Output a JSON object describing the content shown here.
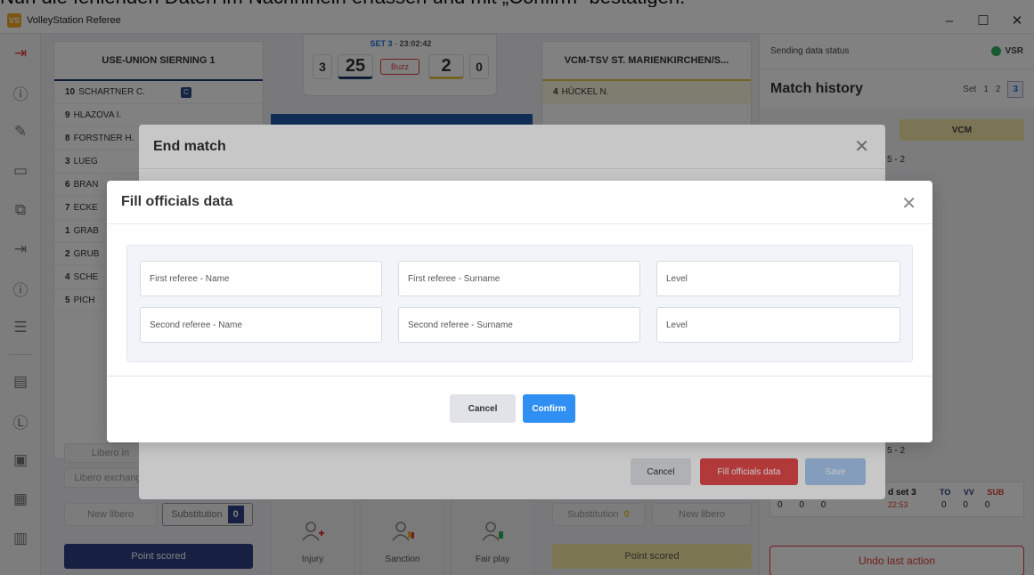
{
  "caption": "Nun die fehlenden Daten im Nachhinein erfassen und mit „Confirm“ bestätigen.",
  "window": {
    "title": "VolleyStation Referee"
  },
  "home_team": {
    "name": "USE-UNION SIERNING 1",
    "players": [
      {
        "num": "10",
        "name": "SCHARTNER C.",
        "captain": "C"
      },
      {
        "num": "9",
        "name": "HLAZOVA I."
      },
      {
        "num": "8",
        "name": "FORSTNER H."
      },
      {
        "num": "3",
        "name": "LUEG"
      },
      {
        "num": "6",
        "name": "BRAN"
      },
      {
        "num": "7",
        "name": "ECKE"
      },
      {
        "num": "1",
        "name": "GRAB"
      },
      {
        "num": "2",
        "name": "GRUB"
      },
      {
        "num": "4",
        "name": "SCHE"
      },
      {
        "num": "5",
        "name": "PICH"
      }
    ],
    "libero_in": "Libero in",
    "libero_exchange": "Libero exchange",
    "new_libero": "New libero",
    "substitution": "Substitution",
    "sub_count": "0",
    "point_scored": "Point scored"
  },
  "away_team": {
    "name": "VCM-TSV ST. MARIENKIRCHEN/S...",
    "players": [
      {
        "num": "4",
        "name": "HÜCKEL N."
      }
    ],
    "substitution": "Substitution",
    "sub_count": "0",
    "new_libero": "New libero",
    "point_scored": "Point scored"
  },
  "score": {
    "set_label": "SET 3",
    "sep": "-",
    "time": "23:02:42",
    "home_sets": "3",
    "home_points": "25",
    "buzz": "Buzz",
    "away_points": "2",
    "away_sets": "0"
  },
  "tools": [
    {
      "label": "Injury"
    },
    {
      "label": "Sanction"
    },
    {
      "label": "Fair play"
    }
  ],
  "right_panel": {
    "status_label": "Sending data status",
    "status_tag": "VSR",
    "status_color": "#2fb35a",
    "history_title": "Match history",
    "set_label": "Set",
    "sets": [
      "1",
      "2",
      "3"
    ],
    "active_set": "3",
    "vcm_label": "VCM",
    "score_a": "5 - 2",
    "score_b": "5 - 2",
    "end_set_label": "d set 3",
    "end_set_time": "22:53",
    "stat_headers": [
      "TO",
      "VV",
      "SUB"
    ],
    "left_values": [
      "0",
      "0",
      "0"
    ],
    "right_values": [
      "0",
      "0",
      "0"
    ],
    "undo": "Undo last action"
  },
  "end_match_modal": {
    "title": "End match",
    "cancel": "Cancel",
    "fill_officials": "Fill officials data",
    "save": "Save"
  },
  "officials_modal": {
    "title": "Fill officials data",
    "first_name_ph": "First referee - Name",
    "first_surname_ph": "First referee - Surname",
    "first_level_ph": "Level",
    "second_name_ph": "Second referee - Name",
    "second_surname_ph": "Second referee - Surname",
    "second_level_ph": "Level",
    "cancel": "Cancel",
    "confirm": "Confirm"
  },
  "colors": {
    "accent": "#2f8ff3",
    "home_navy": "#2f3e84",
    "away_yellow": "#f7eaa1",
    "danger": "#e03b3b"
  }
}
